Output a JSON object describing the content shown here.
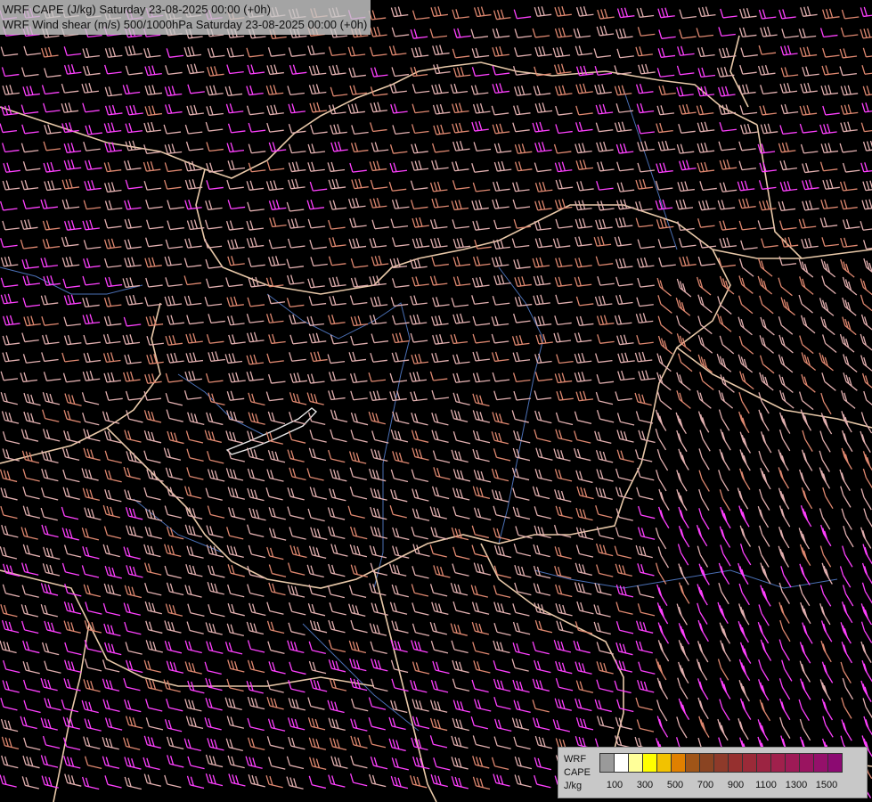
{
  "titles": {
    "line1": "WRF CAPE (J/kg) Saturday 23-08-2025 00:00 (+0h)",
    "line2": "WRF Wind shear (m/s) 500/1000hPa Saturday 23-08-2025 00:00 (+0h)"
  },
  "legend": {
    "label_top": "WRF",
    "label_mid": "CAPE",
    "label_bottom": "J/kg",
    "colors": [
      "#9a9a9a",
      "#ffffff",
      "#ffff99",
      "#ffff00",
      "#f2c200",
      "#e08000",
      "#a05518",
      "#8a4422",
      "#8e3a2a",
      "#96302f",
      "#9a2a38",
      "#9c2442",
      "#a0204c",
      "#9e1a56",
      "#9a1460",
      "#94106a",
      "#8c0a72"
    ],
    "ticks": [
      "100",
      "300",
      "500",
      "700",
      "900",
      "1100",
      "1300",
      "1500"
    ]
  },
  "map": {
    "layers": [
      "cape-shading",
      "wind-shear-barbs",
      "borders",
      "rivers"
    ],
    "barb_colors": {
      "low": "#e3b0b0",
      "mid": "#e08870",
      "high": "#ff40ff"
    }
  }
}
